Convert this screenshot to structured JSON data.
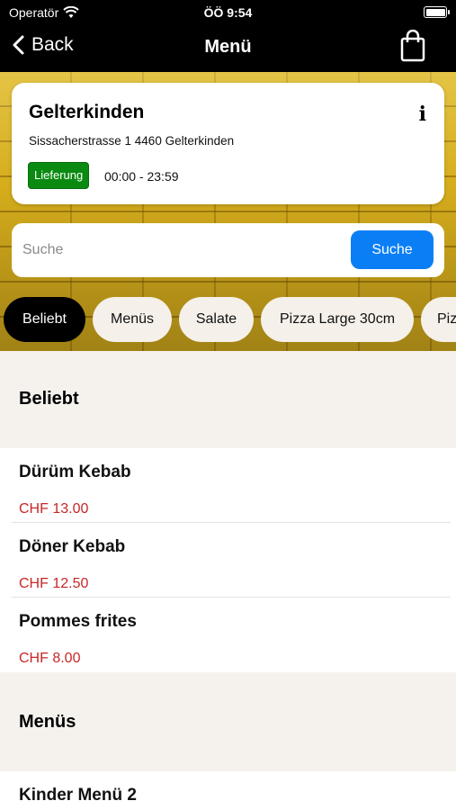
{
  "status_bar": {
    "carrier": "Operatör",
    "time": "ÖÖ 9:54"
  },
  "nav": {
    "back_label": "Back",
    "title": "Menü"
  },
  "store": {
    "name": "Gelterkinden",
    "address": "Sissacherstrasse 1 4460 Gelterkinden",
    "badge": "Lieferung",
    "hours": "00:00 - 23:59"
  },
  "search": {
    "placeholder": "Suche",
    "button_label": "Suche"
  },
  "categories": [
    "Beliebt",
    "Menüs",
    "Salate",
    "Pizza Large 30cm",
    "Pizza"
  ],
  "sections": [
    {
      "title": "Beliebt",
      "items": [
        {
          "name": "Dürüm Kebab",
          "price": "CHF 13.00"
        },
        {
          "name": "Döner Kebab",
          "price": "CHF 12.50"
        },
        {
          "name": "Pommes frites",
          "price": "CHF 8.00"
        }
      ]
    },
    {
      "title": "Menüs",
      "items": [
        {
          "name": "Kinder Menü 2"
        }
      ]
    }
  ],
  "colors": {
    "badge_green": "#0a8a11",
    "search_blue": "#0a7ff5",
    "price_red": "#c62828"
  }
}
